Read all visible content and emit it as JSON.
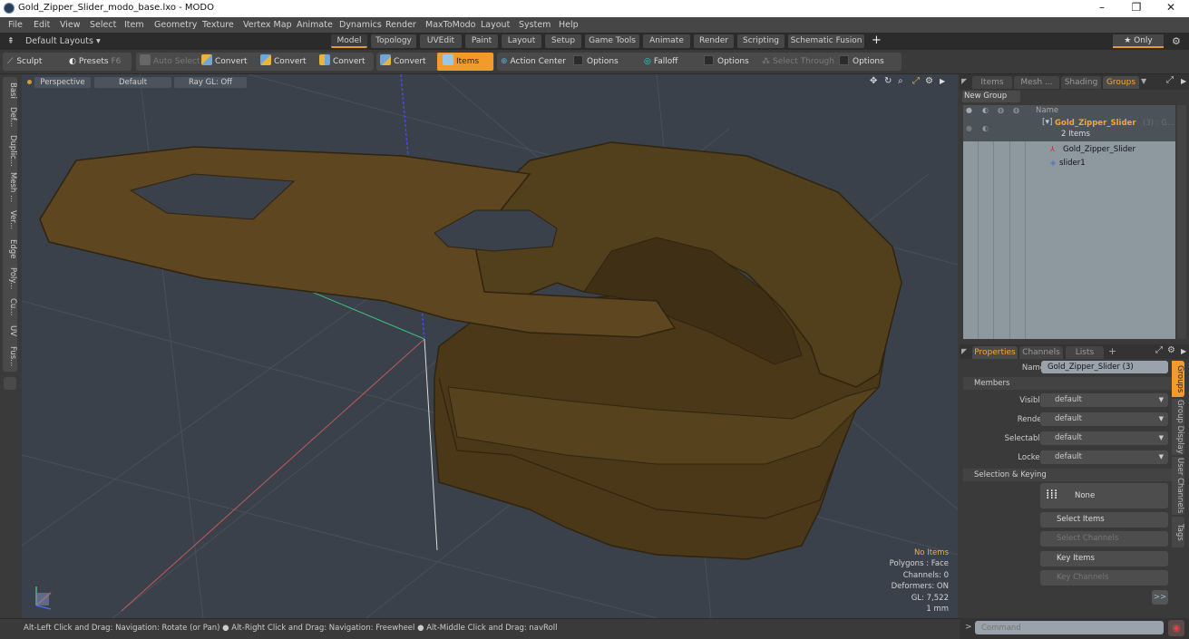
{
  "window": {
    "title": "Gold_Zipper_Slider_modo_base.lxo - MODO",
    "controls": [
      "–",
      "❐",
      "✕"
    ]
  },
  "menu": [
    "File",
    "Edit",
    "View",
    "Select",
    "Item",
    "Geometry",
    "Texture",
    "Vertex Map",
    "Animate",
    "Dynamics",
    "Render",
    "MaxToModo",
    "Layout",
    "System",
    "Help"
  ],
  "layout_bar": {
    "layouts_label": "Default Layouts ▾",
    "tabs": [
      "Model",
      "Topology",
      "UVEdit",
      "Paint",
      "Layout",
      "Setup",
      "Game Tools",
      "Animate",
      "Render",
      "Scripting",
      "Schematic Fusion"
    ],
    "active_tab": "Model",
    "add_label": "+",
    "only_label": "★ Only"
  },
  "toolbar": {
    "sculpt": "Sculpt",
    "presets": "Presets",
    "presets_key": "F6",
    "auto_select": "Auto Select",
    "convert1": "Convert",
    "convert2": "Convert",
    "convert3": "Convert",
    "convert4": "Convert",
    "items": "Items",
    "action_center": "Action Center",
    "options1": "Options",
    "falloff": "Falloff",
    "options2": "Options",
    "select_through": "Select Through",
    "options3": "Options"
  },
  "left_tabs": [
    "Basi",
    "Def...",
    "Duplic...",
    "Mesh ...",
    "Ver...",
    "Edge",
    "Poly...",
    "Cu...",
    "UV",
    "Fus..."
  ],
  "viewport": {
    "view": "Perspective",
    "shading": "Default",
    "raygl": "Ray GL: Off",
    "info": {
      "selection": "No Items",
      "polygons": "Polygons : Face",
      "channels": "Channels: 0",
      "deformers": "Deformers: ON",
      "gl": "GL: 7,522",
      "unit": "1 mm"
    },
    "colors": {
      "background": "#3b414a",
      "mesh": "#5a4420",
      "selection_info": "#f2b13a"
    }
  },
  "status": "Alt-Left Click and Drag: Navigation: Rotate (or Pan) ● Alt-Right Click and Drag: Navigation: Freewheel ● Alt-Middle Click and Drag: navRoll",
  "groups_panel": {
    "tabs": [
      "Items",
      "Mesh ...",
      "Shading",
      "Groups"
    ],
    "active_tab": "Groups",
    "new_group": "New Group",
    "column_name": "Name",
    "group": {
      "name": "Gold_Zipper_Slider",
      "suffix": "(3) : G...",
      "count": "2 Items"
    },
    "children": [
      "Gold_Zipper_Slider",
      "slider1"
    ]
  },
  "properties_panel": {
    "tabs": [
      "Properties",
      "Channels",
      "Lists"
    ],
    "active_tab": "Properties",
    "add_label": "+",
    "name_label": "Name",
    "name_value": "Gold_Zipper_Slider (3)",
    "members_section": "Members",
    "members": [
      {
        "label": "Visible",
        "value": "default"
      },
      {
        "label": "Render",
        "value": "default"
      },
      {
        "label": "Selectable",
        "value": "default"
      },
      {
        "label": "Locked",
        "value": "default"
      }
    ],
    "selection_section": "Selection & Keying",
    "none_label": "None",
    "buttons": [
      {
        "label": "Select Items",
        "enabled": true
      },
      {
        "label": "Select Channels",
        "enabled": false
      },
      {
        "label": "Key Items",
        "enabled": true
      },
      {
        "label": "Key Channels",
        "enabled": false
      }
    ],
    "more_label": ">>",
    "side_tabs": [
      "Groups",
      "Group Display",
      "User Channels",
      "Tags"
    ],
    "active_side_tab": "Groups"
  },
  "command": {
    "prompt": ">",
    "placeholder": "Command"
  }
}
